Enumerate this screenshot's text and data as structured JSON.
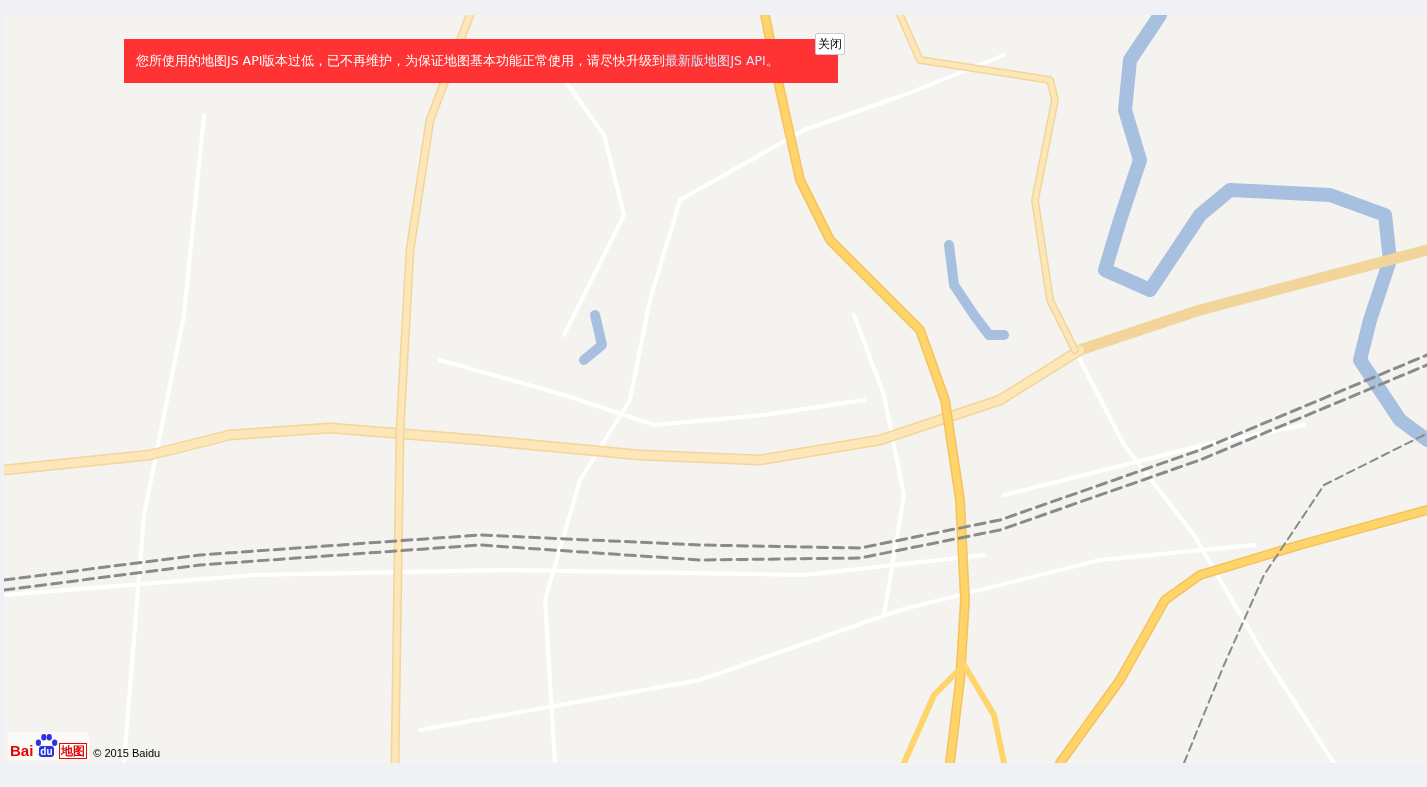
{
  "map": {
    "notice": {
      "text": "您所使用的地图JS API版本过低，已不再维护，为保证地图基本功能正常使用，请尽快升级到",
      "link": "最新版地图JS API",
      "tail": "。"
    },
    "close_button": "关闭",
    "logo": {
      "left": "Bai",
      "paw": "du",
      "right": "地图"
    },
    "copyright": "© 2015 Baidu"
  }
}
